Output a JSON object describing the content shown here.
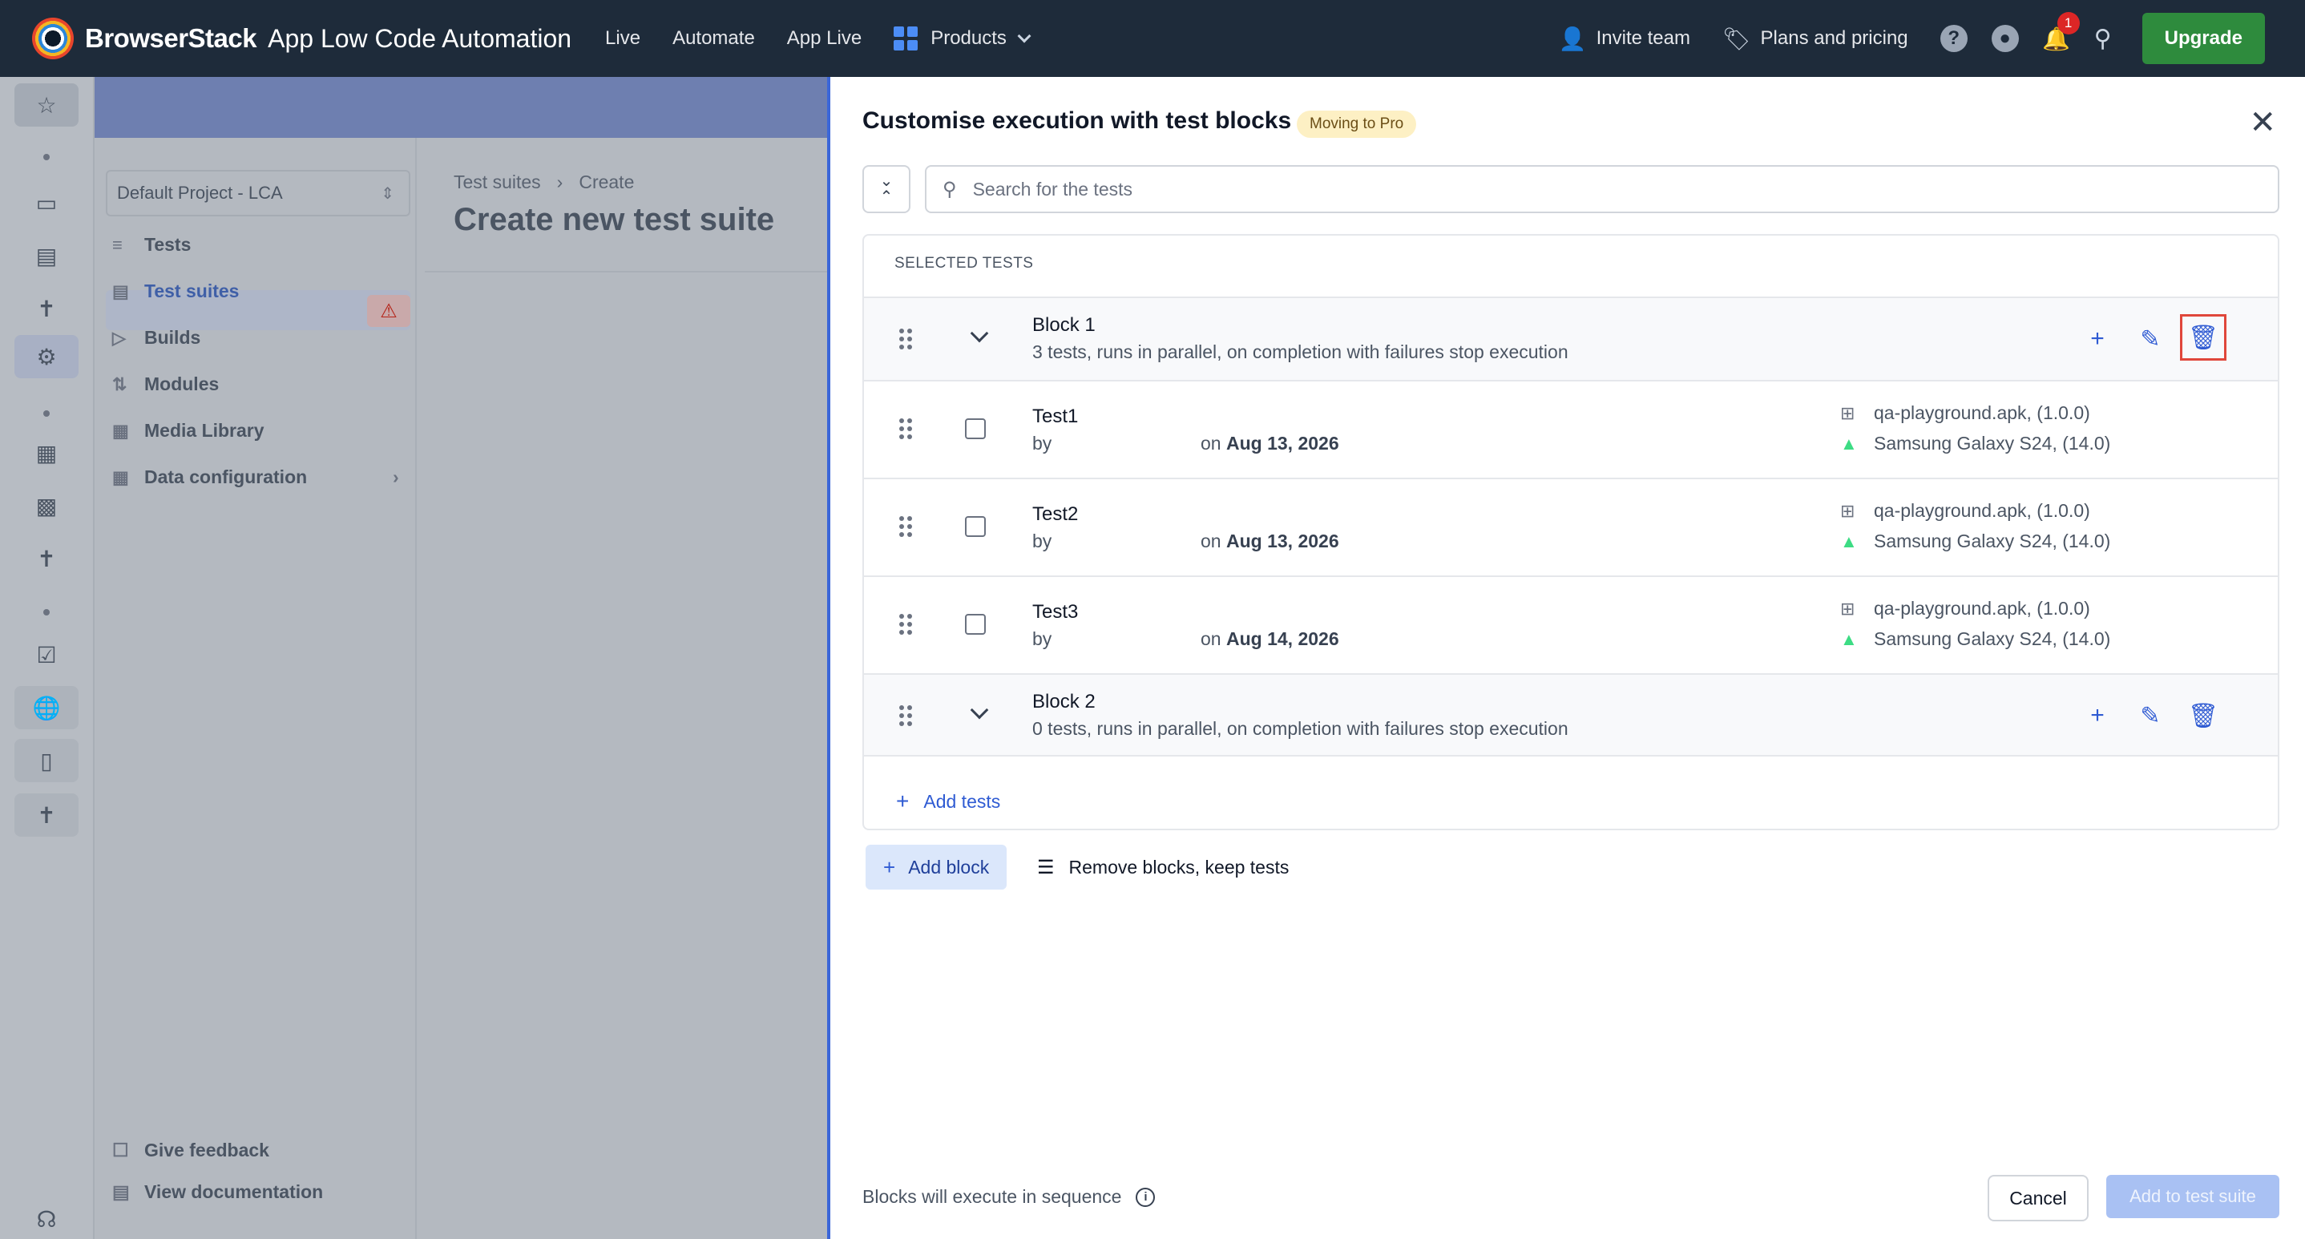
{
  "topbar": {
    "brand": "BrowserStack",
    "product": "App Low Code Automation",
    "nav": [
      "Live",
      "Automate",
      "App Live"
    ],
    "products_label": "Products",
    "invite": "Invite team",
    "plans": "Plans and pricing",
    "notification_count": "1",
    "upgrade": "Upgrade"
  },
  "sidebar": {
    "project": "Default Project - LCA",
    "items": [
      {
        "label": "Tests"
      },
      {
        "label": "Test suites"
      },
      {
        "label": "Builds"
      },
      {
        "label": "Modules"
      },
      {
        "label": "Media Library"
      },
      {
        "label": "Data configuration"
      }
    ],
    "feedback": "Give feedback",
    "docs": "View documentation"
  },
  "background_page": {
    "breadcrumb": [
      "Test suites",
      "Create"
    ],
    "title": "Create new test suite"
  },
  "drawer": {
    "title": "Customise execution with test blocks",
    "pill": "Moving to Pro",
    "search_placeholder": "Search for the tests",
    "section_label": "SELECTED TESTS",
    "blocks": [
      {
        "name": "Block 1",
        "desc": "3 tests, runs in parallel, on completion with failures stop execution"
      },
      {
        "name": "Block 2",
        "desc": "0 tests, runs in parallel, on completion with failures stop execution"
      }
    ],
    "tests": [
      {
        "name": "Test1",
        "by": "by",
        "date_prefix": "on",
        "date": "Aug 13, 2026",
        "app": "qa-playground.apk, (1.0.0)",
        "device": "Samsung Galaxy S24, (14.0)"
      },
      {
        "name": "Test2",
        "by": "by",
        "date_prefix": "on",
        "date": "Aug 13, 2026",
        "app": "qa-playground.apk, (1.0.0)",
        "device": "Samsung Galaxy S24, (14.0)"
      },
      {
        "name": "Test3",
        "by": "by",
        "date_prefix": "on",
        "date": "Aug 14, 2026",
        "app": "qa-playground.apk, (1.0.0)",
        "device": "Samsung Galaxy S24, (14.0)"
      }
    ],
    "add_tests": "Add tests",
    "add_block": "Add block",
    "remove_blocks": "Remove blocks, keep tests",
    "footer_note": "Blocks will execute in sequence",
    "cancel": "Cancel",
    "submit": "Add to test suite"
  },
  "colors": {
    "accent": "#2f5bd3",
    "topbar": "#1e2b3a",
    "upgrade": "#2e8b3d",
    "highlight": "#e0473b"
  }
}
